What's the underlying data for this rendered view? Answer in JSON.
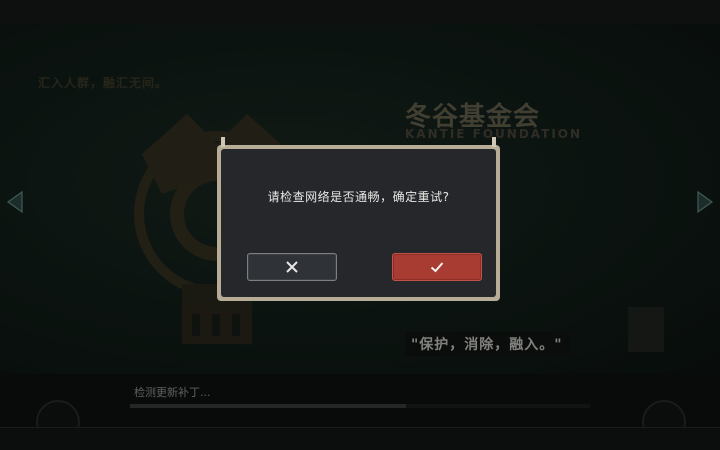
{
  "background": {
    "slogan": "汇入人群，融汇无间。",
    "foundation_cn": "冬谷基金会",
    "foundation_en": "KANTIE FOUNDATION",
    "motto": "\"保护，消除，融入。\""
  },
  "loading": {
    "status_text": "检测更新补丁...",
    "progress": 0.6
  },
  "dialog": {
    "message": "请检查网络是否通畅，确定重试?",
    "cancel_icon": "close-icon",
    "confirm_icon": "check-icon"
  },
  "colors": {
    "confirm": "#a83b32",
    "cancel": "#2f3236",
    "frame": "#b7ad97"
  }
}
